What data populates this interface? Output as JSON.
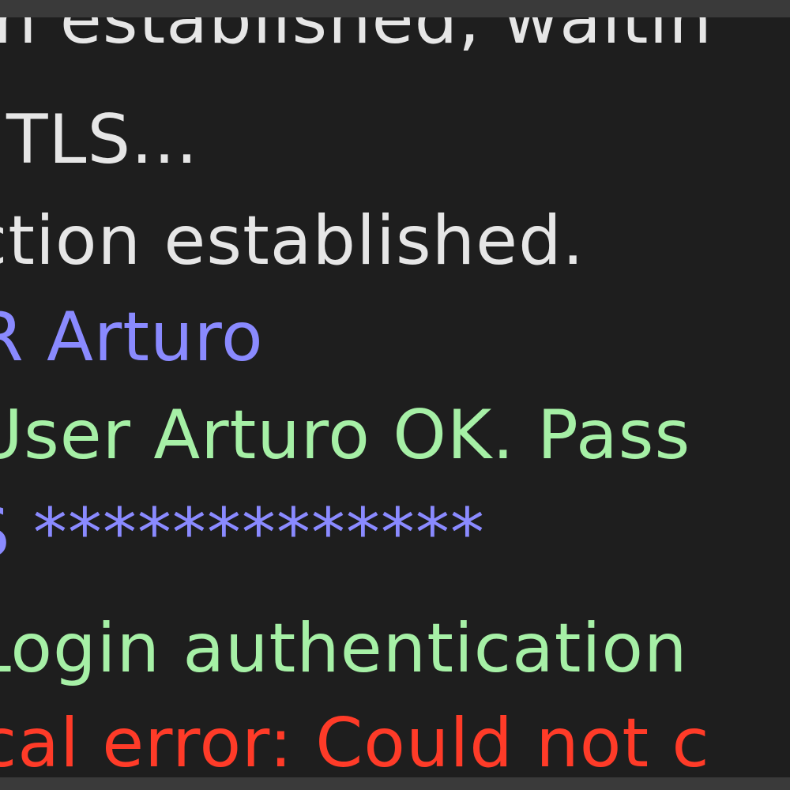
{
  "log": {
    "lines": [
      {
        "text": "n established, waitin",
        "color": "#e6e6e6"
      },
      {
        "text": "TLS...",
        "color": "#e6e6e6"
      },
      {
        "text": "ction established.",
        "color": "#e6e6e6"
      },
      {
        "text": "R Arturo",
        "color": "#8a8aff"
      },
      {
        "text": "User Arturo OK. Pass",
        "color": "#a6f0a6"
      },
      {
        "text": "S *************",
        "color": "#8a8aff"
      },
      {
        "text": "Login authentication",
        "color": "#a6f0a6"
      },
      {
        "text": "cal error: Could not c",
        "color": "#ff3b28"
      }
    ]
  }
}
